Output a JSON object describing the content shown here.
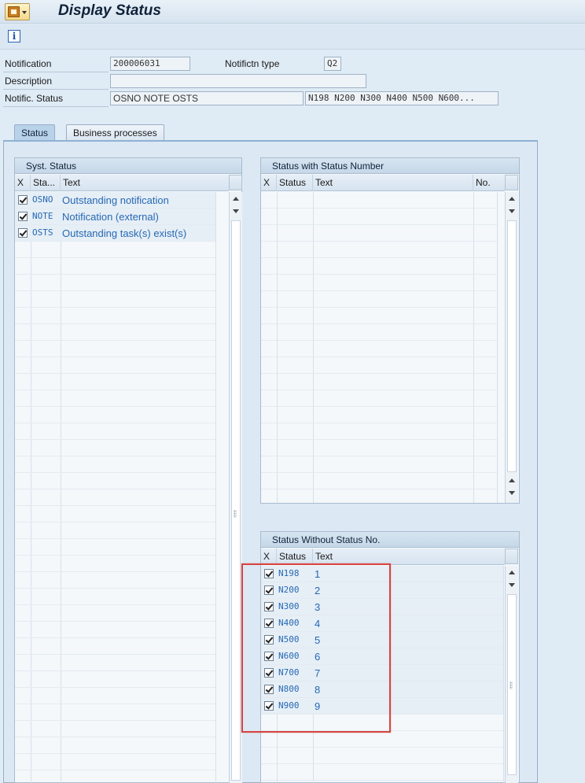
{
  "window": {
    "title": "Display Status"
  },
  "header": {
    "notification": {
      "label": "Notification",
      "value": "200006031"
    },
    "notif_type": {
      "label": "Notifictn type",
      "value": "Q2"
    },
    "description": {
      "label": "Description",
      "value": ""
    },
    "status": {
      "label": "Notific. Status",
      "value": "OSNO NOTE OSTS",
      "user_status": "N198 N200 N300 N400 N500 N600..."
    }
  },
  "tabs": [
    {
      "label": "Status",
      "active": true
    },
    {
      "label": "Business processes",
      "active": false
    }
  ],
  "syst_status": {
    "title": "Syst. Status",
    "columns": [
      "X",
      "Sta...",
      "Text"
    ],
    "rows": [
      {
        "checked": true,
        "code": "OSNO",
        "text": "Outstanding notification"
      },
      {
        "checked": true,
        "code": "NOTE",
        "text": "Notification (external)"
      },
      {
        "checked": true,
        "code": "OSTS",
        "text": "Outstanding task(s) exist(s)"
      }
    ]
  },
  "status_with_no": {
    "title": "Status with Status Number",
    "columns": [
      "X",
      "Status",
      "Text",
      "No."
    ],
    "rows": []
  },
  "status_without_no": {
    "title": "Status Without Status No.",
    "columns": [
      "X",
      "Status",
      "Text"
    ],
    "rows": [
      {
        "checked": true,
        "code": "N198",
        "text": "1"
      },
      {
        "checked": true,
        "code": "N200",
        "text": "2"
      },
      {
        "checked": true,
        "code": "N300",
        "text": "3"
      },
      {
        "checked": true,
        "code": "N400",
        "text": "4"
      },
      {
        "checked": true,
        "code": "N500",
        "text": "5"
      },
      {
        "checked": true,
        "code": "N600",
        "text": "6"
      },
      {
        "checked": true,
        "code": "N700",
        "text": "7"
      },
      {
        "checked": true,
        "code": "N800",
        "text": "8"
      },
      {
        "checked": true,
        "code": "N900",
        "text": "9"
      }
    ]
  },
  "icons": {
    "menu": "sap-menu-icon",
    "info": "info-icon",
    "scroll_up": "scroll-up-icon",
    "scroll_down": "scroll-down-icon"
  },
  "colors": {
    "link_text": "#2669b3",
    "highlight_border": "#d64541",
    "panel_bg": "#dce8f3"
  }
}
